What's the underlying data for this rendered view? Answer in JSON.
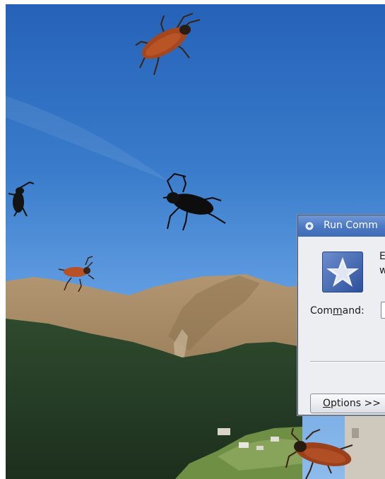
{
  "desktop": {
    "wallpaper": "mountain-valley-sky",
    "bug_count": 6
  },
  "run_dialog": {
    "title": "Run Comm",
    "description_line1": "E",
    "description_line2": "w",
    "command_label_pre": "Com",
    "command_label_accel": "m",
    "command_label_post": "and:",
    "command_value": "",
    "options_accel": "O",
    "options_label_post": "ptions >>",
    "icon": "star-app-icon",
    "title_icon": "gear-icon"
  },
  "colors": {
    "titlebar": "#4a78c2",
    "sky": "#2f6fc0",
    "dialog_bg": "#eceef1"
  }
}
